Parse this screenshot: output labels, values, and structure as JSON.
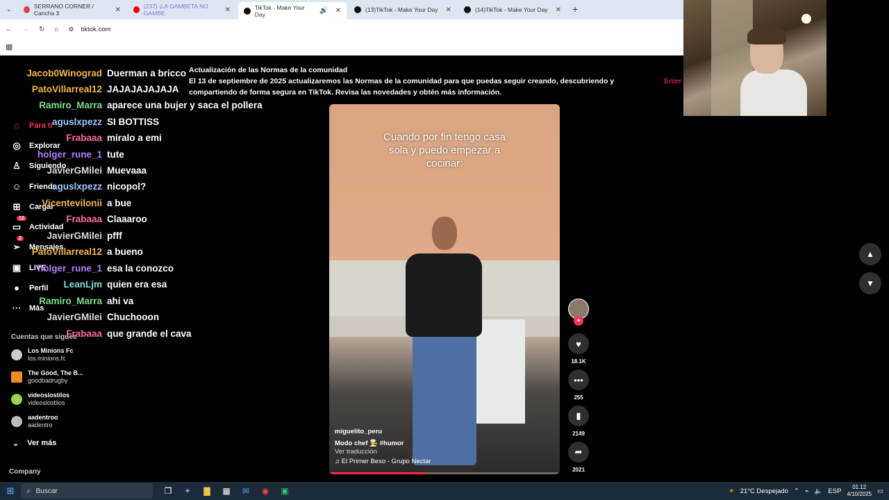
{
  "browser": {
    "tabs": [
      {
        "label": "SERRANO CORNER / Cancha 3",
        "favicon_color": "#d44"
      },
      {
        "label": "(237) ¡LA GAMBETA NO GAMBE",
        "favicon_color": "#f00"
      },
      {
        "label": "TikTok - Make Your Day",
        "favicon_color": "#111"
      },
      {
        "label": "(13)TikTok - Make Your Day",
        "favicon_color": "#111"
      },
      {
        "label": "(14)TikTok - Make Your Day",
        "favicon_color": "#111"
      }
    ],
    "url": "tiktok.com"
  },
  "sidebar": {
    "items": [
      {
        "label": "Para ti",
        "icon": "home-icon"
      },
      {
        "label": "Explorar",
        "icon": "compass-icon"
      },
      {
        "label": "Siguiendo",
        "icon": "following-icon"
      },
      {
        "label": "Friends",
        "icon": "friends-icon"
      },
      {
        "label": "Cargar",
        "icon": "upload-icon"
      },
      {
        "label": "Actividad",
        "icon": "activity-icon",
        "badge": "12"
      },
      {
        "label": "Mensajes",
        "icon": "messages-icon",
        "badge": "2"
      },
      {
        "label": "LIVE",
        "icon": "live-icon"
      },
      {
        "label": "Perfil",
        "icon": "profile-icon"
      },
      {
        "label": "Más",
        "icon": "more-icon"
      }
    ],
    "following_title": "Cuentas que sigues",
    "accounts": [
      {
        "name": "Los Minions Fc",
        "handle": "los.minions.fc"
      },
      {
        "name": "The Good, The B...",
        "handle": "goodbadrugby"
      },
      {
        "name": "videoslostilos",
        "handle": "videoslostilos"
      },
      {
        "name": "aadentroo",
        "handle": "aadentro"
      }
    ],
    "see_more": "Ver más",
    "company": "Company"
  },
  "chat": [
    {
      "user": "Jacob0Winograd",
      "msg": "Duerman a bricco",
      "color": "#f5b942"
    },
    {
      "user": "PatoVillarreal12",
      "msg": "JAJAJAJAJAJA",
      "color": "#f5b942"
    },
    {
      "user": "Ramiro_Marra",
      "msg": "aparece una bujer y saca el pollera",
      "color": "#7ee08a"
    },
    {
      "user": "aguslxpezz",
      "msg": "SI BOTTISS",
      "color": "#9ec9ff"
    },
    {
      "user": "Frabaaa",
      "msg": "míralo a emi",
      "color": "#ff6b9a"
    },
    {
      "user": "holger_rune_1",
      "msg": "tute",
      "color": "#b47cff"
    },
    {
      "user": "JavierGMilei",
      "msg": "Muevaaa",
      "color": "#dddddd"
    },
    {
      "user": "aguslxpezz",
      "msg": "nicopol?",
      "color": "#9ec9ff"
    },
    {
      "user": "Vicentevilonii",
      "msg": "a bue",
      "color": "#f5b942"
    },
    {
      "user": "Frabaaa",
      "msg": "Claaaroo",
      "color": "#ff6b9a"
    },
    {
      "user": "JavierGMilei",
      "msg": "pfff",
      "color": "#dddddd"
    },
    {
      "user": "PatoVillarreal12",
      "msg": "a bueno",
      "color": "#f5b942"
    },
    {
      "user": "holger_rune_1",
      "msg": "esa la conozco",
      "color": "#b47cff"
    },
    {
      "user": "LeanLjm",
      "msg": "quien era esa",
      "color": "#7fe0d6"
    },
    {
      "user": "Ramiro_Marra",
      "msg": "ahi va",
      "color": "#7ee08a"
    },
    {
      "user": "JavierGMilei",
      "msg": "Chuchooon",
      "color": "#dddddd"
    },
    {
      "user": "Frabaaa",
      "msg": "que grande el cava",
      "color": "#ff6b9a"
    }
  ],
  "notice": {
    "title": "Actualización de las Normas de la comunidad",
    "body": "El 13 de septiembre de 2025 actualizaremos las Normas de la comunidad para que puedas seguir creando, descubriendo y compartiendo de forma segura en TikTok. Revisa las novedades y obtén más información.",
    "enter": "Enter"
  },
  "video": {
    "caption": "Cuando por fin tengo casa sola y puedo empezar a cocinar:",
    "author": "miguelito_peru",
    "description": "Modo chef 👨‍🍳  #humor",
    "translate": "Ver traducción",
    "music": "♫ El Primer Beso - Grupo Nectar",
    "progress_fraction": 0.42
  },
  "actions": {
    "likes": "18.1K",
    "comments": "255",
    "saves": "2149",
    "shares": "2021"
  },
  "taskbar": {
    "search_placeholder": "Buscar",
    "weather": "21°C  Despejado",
    "lang": "ESP",
    "time": "01:12",
    "date": "4/10/2025"
  }
}
